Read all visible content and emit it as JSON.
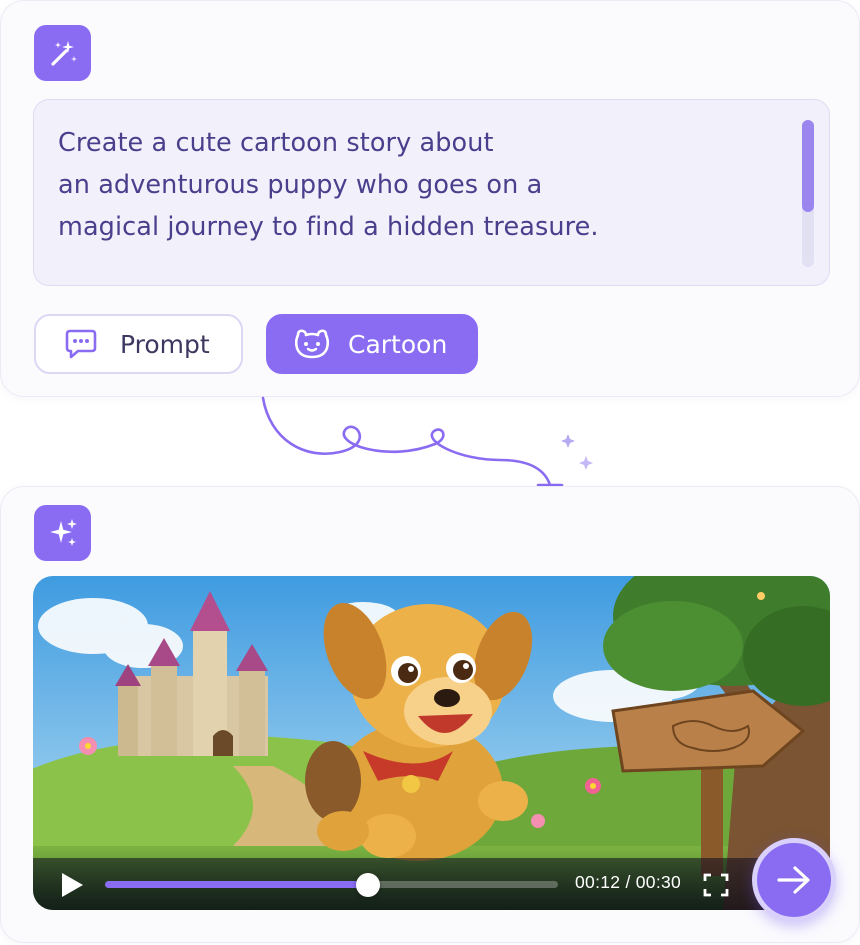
{
  "prompt_card": {
    "badge_icon": "magic-wand-icon",
    "prompt_text": "Create a cute cartoon story about\nan adventurous puppy who goes on a\nmagical journey to find a hidden treasure.",
    "chips": {
      "prompt": {
        "label": "Prompt",
        "icon": "chat-bubble-icon"
      },
      "cartoon": {
        "label": "Cartoon",
        "icon": "cartoon-face-icon"
      }
    }
  },
  "result_card": {
    "badge_icon": "sparkles-icon",
    "video": {
      "scene_elements": [
        "castle",
        "puppy",
        "wooden-signpost",
        "tree",
        "flowers",
        "path"
      ],
      "current_time": "00:12",
      "total_time": "00:30",
      "time_display": "00:12 / 00:30",
      "progress": 0.58
    }
  },
  "next_button_icon": "arrow-right-icon",
  "colors": {
    "accent": "#8a6cf2",
    "accent_light": "#d9d1fb",
    "prompt_text": "#4a3f8c",
    "card_bg": "#fbfbfe",
    "prompt_bg": "#f1f0fb"
  }
}
